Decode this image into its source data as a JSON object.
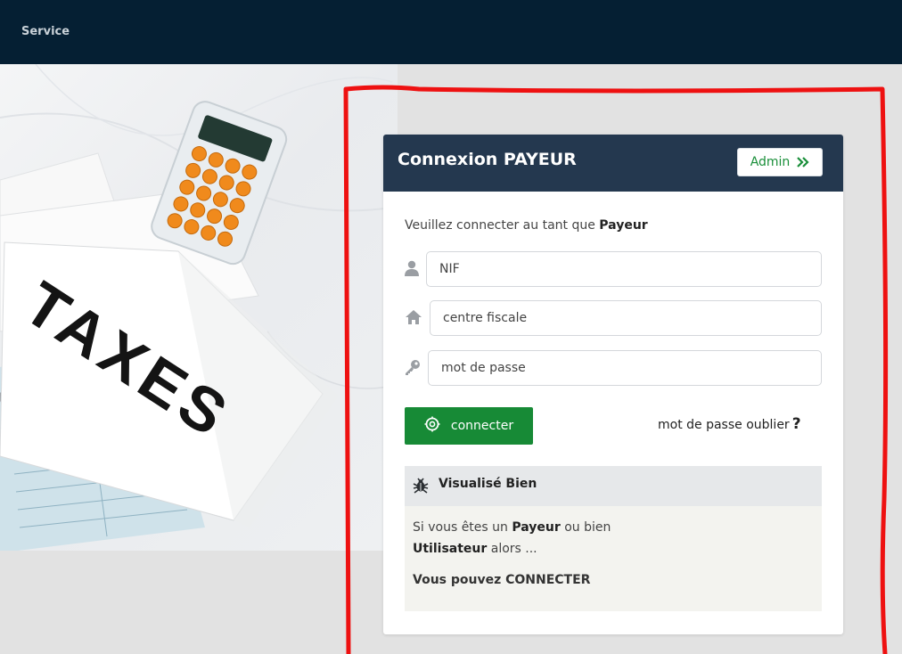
{
  "topbar": {
    "brand": "Service"
  },
  "hero": {
    "sign_text": "TAXES"
  },
  "card": {
    "title": "Connexion PAYEUR",
    "admin_label": "Admin",
    "intro_prefix": "Veuillez connecter au tant que ",
    "intro_role": "Payeur",
    "fields": {
      "nif_placeholder": "NIF",
      "centre_placeholder": "centre fiscale",
      "password_placeholder": "mot de passe"
    },
    "connect_label": "connecter",
    "forgot_label": "mot de passe oublier",
    "forgot_mark": "?",
    "info": {
      "title": "Visualisé Bien",
      "line1_prefix": "Si vous êtes un ",
      "line1_role": "Payeur",
      "line1_suffix": " ou bien",
      "line2_role": "Utilisateur",
      "line2_suffix": " alors ...",
      "cta": "Vous pouvez CONNECTER"
    }
  },
  "icons": {
    "nif": "user-icon",
    "centre": "home-icon",
    "password": "key-icon",
    "connect": "gear-icon",
    "admin": "double-chevron-right-icon",
    "info": "bug-icon"
  },
  "colors": {
    "topbar": "#051f33",
    "card_header": "#24384f",
    "accent_green": "#178a36",
    "annotation_red": "#ee1111"
  }
}
